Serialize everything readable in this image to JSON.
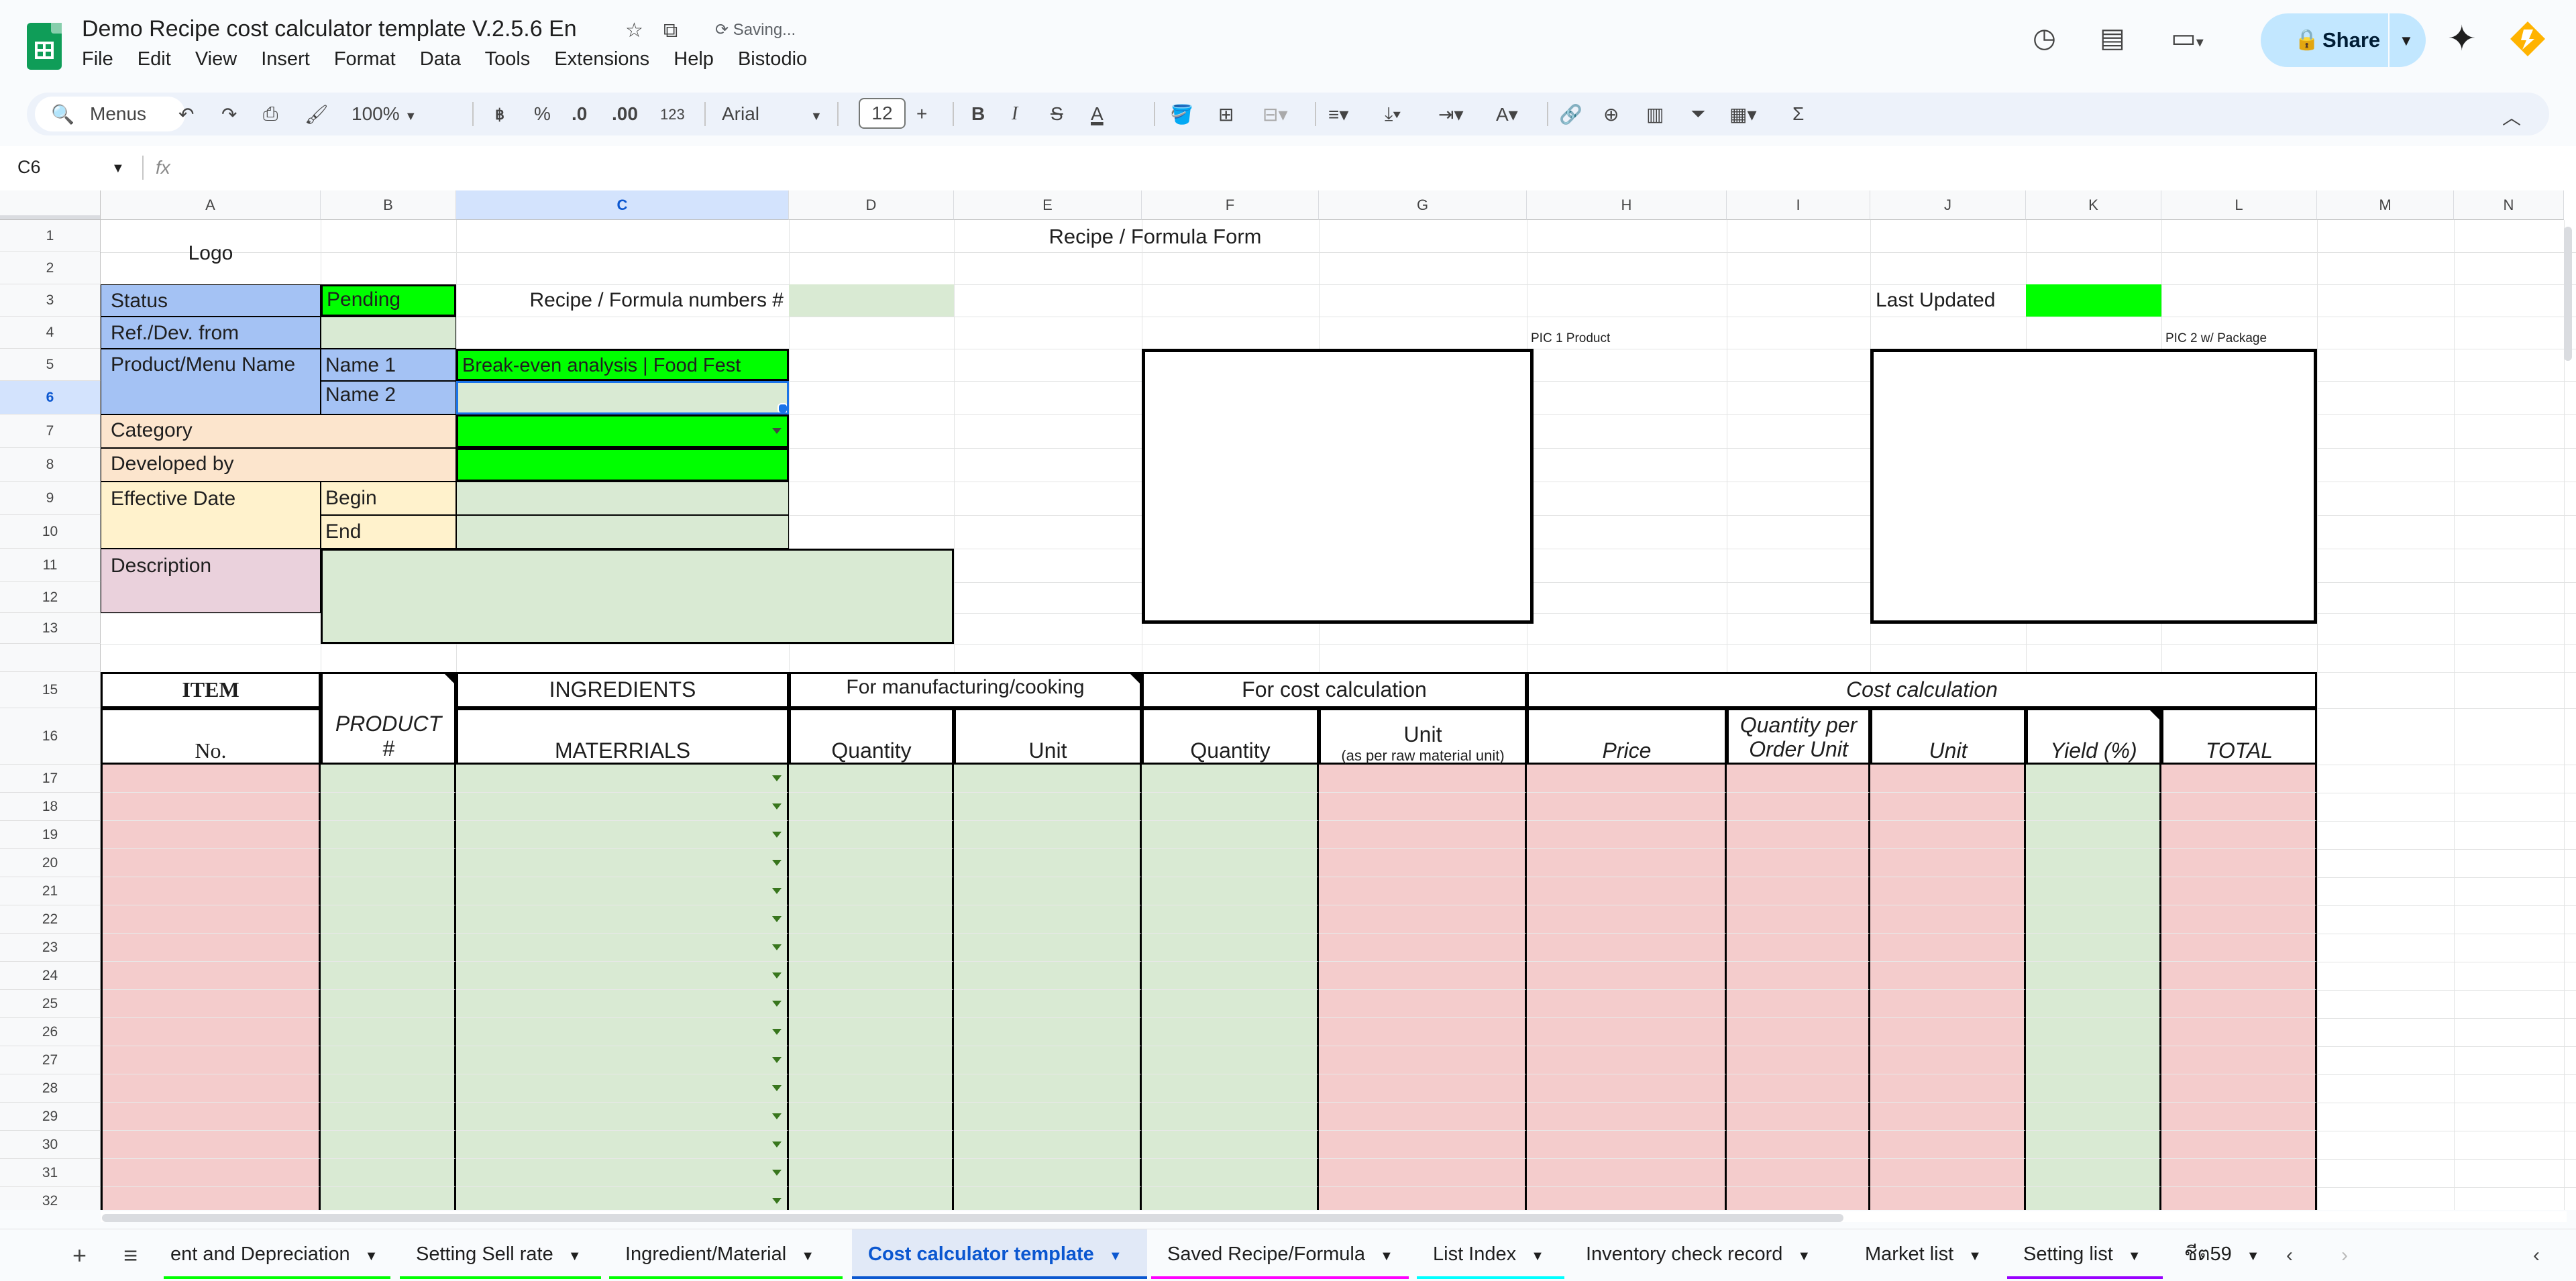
{
  "doc": {
    "title": "Demo Recipe cost calculator template V.2.5.6 En",
    "status": "Saving..."
  },
  "menus": [
    "File",
    "Edit",
    "View",
    "Insert",
    "Format",
    "Data",
    "Tools",
    "Extensions",
    "Help",
    "Bistodio"
  ],
  "share_label": "Share",
  "toolbar": {
    "search": "Menus",
    "zoom": "100%",
    "percent": "%",
    "dec_dec": ".0",
    "dec_inc": ".00",
    "number_format": "123",
    "font": "Arial",
    "font_size": "12",
    "b": "B",
    "i": "I",
    "s": "S",
    "a": "A",
    "sigma": "Σ"
  },
  "namebox": "C6",
  "fx": "fx",
  "columns": [
    "A",
    "B",
    "C",
    "D",
    "E",
    "F",
    "G",
    "H",
    "I",
    "J",
    "K",
    "L",
    "M",
    "N"
  ],
  "rows": [
    "1",
    "2",
    "3",
    "4",
    "5",
    "6",
    "7",
    "8",
    "9",
    "10",
    "11",
    "12",
    "13",
    "",
    "15",
    "16",
    "17",
    "18",
    "19",
    "20",
    "21",
    "22",
    "23",
    "24",
    "25",
    "26",
    "27",
    "28",
    "29",
    "30",
    "31",
    "32"
  ],
  "form": {
    "logo": "Logo",
    "form_title": "Recipe / Formula  Form",
    "status_label": "Status",
    "status_value": "Pending",
    "recipe_num_label": "Recipe / Formula numbers #",
    "last_updated_label": "Last Updated",
    "ref_label": "Ref./Dev. from",
    "pic1_label": "PIC 1 Product",
    "pic2_label": "PIC 2 w/ Package",
    "product_label": "Product/Menu Name",
    "name1_label": "Name 1",
    "name1_value": "Break-even analysis | Food Fest",
    "name2_label": "Name 2",
    "category_label": "Category",
    "developed_label": "Developed by",
    "effective_label": "Effective Date",
    "begin_label": "Begin",
    "end_label": "End",
    "description_label": "Description"
  },
  "table": {
    "item": "ITEM",
    "no": "No.",
    "product": "PRODUCT",
    "hash": "#",
    "ingredients": "INGREDIENTS",
    "materials": "MATERRIALS",
    "manufacturing": "For manufacturing/cooking",
    "quantity": "Quantity",
    "unit": "Unit",
    "cost_calc_for": "For cost calculation",
    "quantity2": "Quantity",
    "unit2": "Unit",
    "unit2_sub": "(as per raw material unit)",
    "cost_calc": "Cost calculation",
    "price": "Price",
    "qty_per_order_1": "Quantity per",
    "qty_per_order_2": "Order Unit",
    "unit3": "Unit",
    "yield": "Yield (%)",
    "total": "TOTAL"
  },
  "tabs": [
    {
      "label": "ent and Depreciation",
      "color": "#00ff00"
    },
    {
      "label": "Setting Sell rate",
      "color": "#00ff00"
    },
    {
      "label": "Ingredient/Material",
      "color": "#00ff00"
    },
    {
      "label": "Cost calculator template",
      "color": "#0b57d0",
      "active": true
    },
    {
      "label": "Saved Recipe/Formula",
      "color": "#ff00ff"
    },
    {
      "label": "List Index",
      "color": "#00ffff"
    },
    {
      "label": "Inventory check record",
      "color": ""
    },
    {
      "label": "Market list",
      "color": ""
    },
    {
      "label": "Setting list",
      "color": "#9900ff"
    },
    {
      "label": "ชีต59",
      "color": ""
    }
  ]
}
